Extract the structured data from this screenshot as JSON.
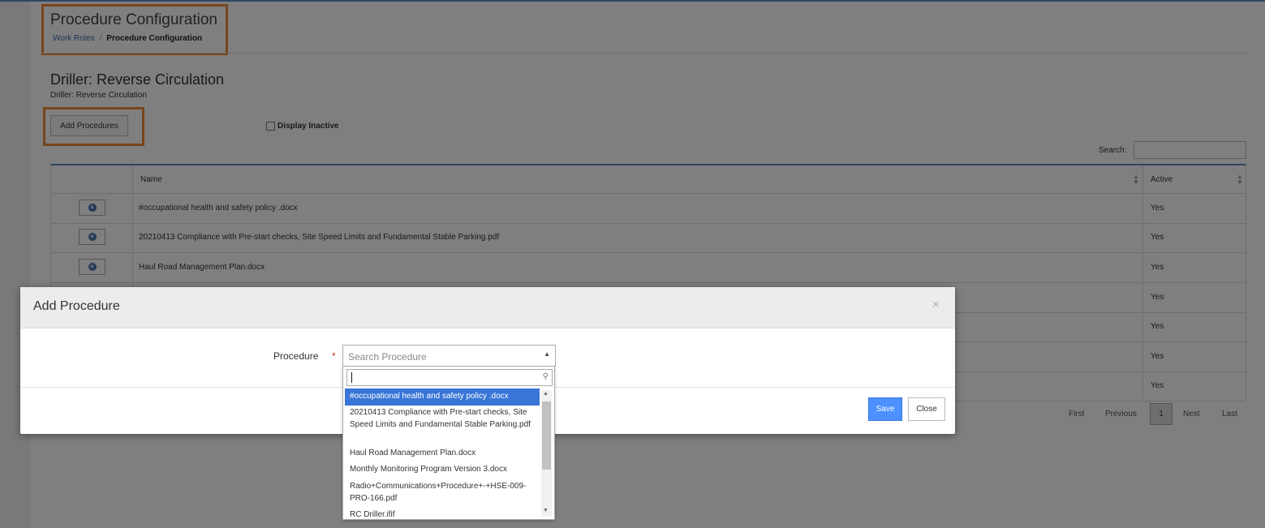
{
  "page": {
    "title": "Procedure Configuration",
    "breadcrumb": {
      "link": "Work Roles",
      "separator": "/",
      "current": "Procedure Configuration"
    }
  },
  "section": {
    "title": "Driller: Reverse Circulation",
    "subtitle": "Driller: Reverse Circulation",
    "add_button": "Add Procedures",
    "display_inactive_label": "Display Inactive",
    "search_label": "Search:"
  },
  "table": {
    "headers": {
      "name": "Name",
      "active": "Active"
    },
    "rows": [
      {
        "name": "#occupational health and safety policy .docx",
        "active": "Yes"
      },
      {
        "name": "20210413 Compliance with Pre-start checks, Site Speed Limits and Fundamental Stable Parking.pdf",
        "active": "Yes"
      },
      {
        "name": "Haul Road Management Plan.docx",
        "active": "Yes"
      },
      {
        "name": "",
        "active": "Yes"
      },
      {
        "name": "",
        "active": "Yes"
      },
      {
        "name": "",
        "active": "Yes"
      },
      {
        "name": "",
        "active": "Yes"
      }
    ]
  },
  "pagination": {
    "first": "First",
    "previous": "Previous",
    "page": "1",
    "next": "Next",
    "last": "Last"
  },
  "modal": {
    "title": "Add Procedure",
    "close_symbol": "×",
    "field_label": "Procedure",
    "required_marker": "*",
    "select_placeholder": "Search Procedure",
    "save": "Save",
    "close": "Close"
  },
  "dropdown": {
    "items": [
      "#occupational health and safety policy .docx",
      "20210413 Compliance with Pre-start checks, Site Speed Limits and Fundamental Stable Parking.pdf",
      "Haul Road Management Plan.docx",
      "Monthly Monitoring Program Version 3.docx",
      "Radio+Communications+Procedure+-+HSE-009-PRO-166.pdf",
      "RC Driller.ifif"
    ],
    "selected_index": 0
  },
  "colors": {
    "accent": "#5b8fc7",
    "highlight_box": "#f08a34",
    "save_button": "#4d90fe",
    "selected_option": "#3875d7"
  },
  "icons": [
    "delete-circle-icon",
    "sort-icon",
    "close-icon",
    "chevron-up-icon",
    "search-icon"
  ]
}
